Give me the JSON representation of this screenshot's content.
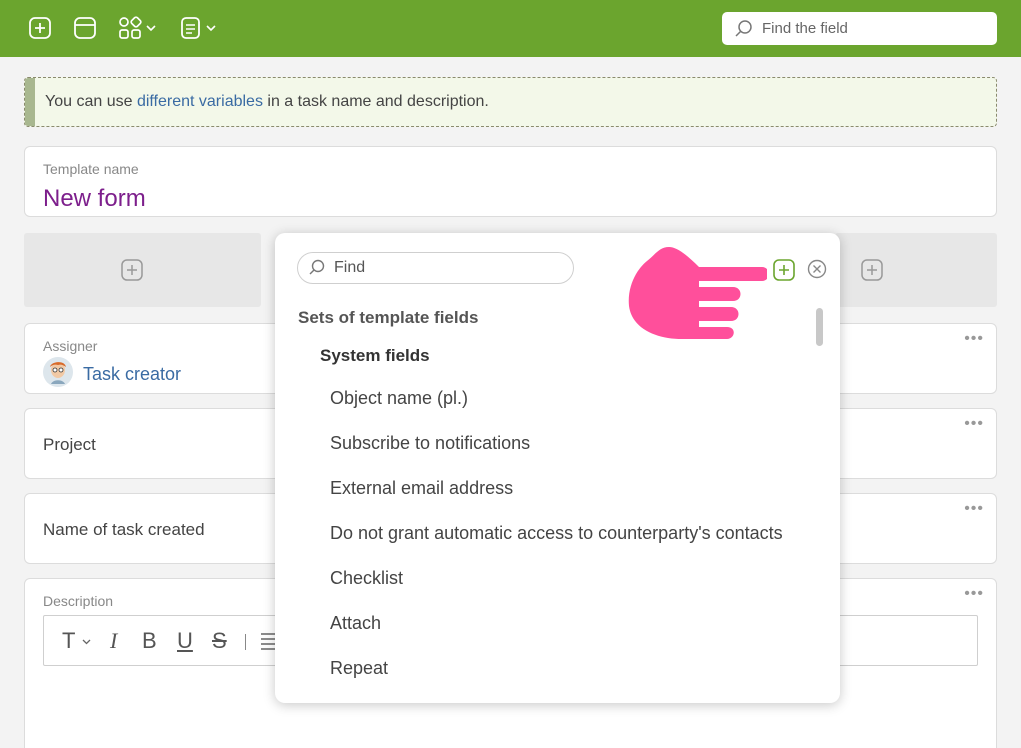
{
  "topbar": {
    "icons": [
      "add-square-icon",
      "window-icon",
      "grid-shapes-icon",
      "chevron-down-icon",
      "document-list-icon",
      "chevron-down-icon"
    ],
    "search_placeholder": "Find the field",
    "color": "#6ba52e"
  },
  "hint": {
    "prefix": "You can use ",
    "link": "different variables",
    "suffix": " in a task name and description."
  },
  "template": {
    "label": "Template name",
    "value": "New form",
    "value_color": "#7d1f8c"
  },
  "assigner": {
    "label": "Assigner",
    "value": "Task creator"
  },
  "project": {
    "label": "Project"
  },
  "task_name": {
    "label": "Name of task created"
  },
  "description": {
    "label": "Description",
    "tools": [
      "T",
      "I",
      "B",
      "U",
      "S"
    ]
  },
  "popup": {
    "search_placeholder": "Find",
    "section": "Sets of template fields",
    "subsection": "System fields",
    "items": [
      "Object name (pl.)",
      "Subscribe to notifications",
      "External email address",
      "Do not grant automatic access to counterparty's contacts",
      "Checklist",
      "Attach",
      "Repeat"
    ],
    "hand_color": "#ff4f9b",
    "add_color": "#6ba52e"
  }
}
